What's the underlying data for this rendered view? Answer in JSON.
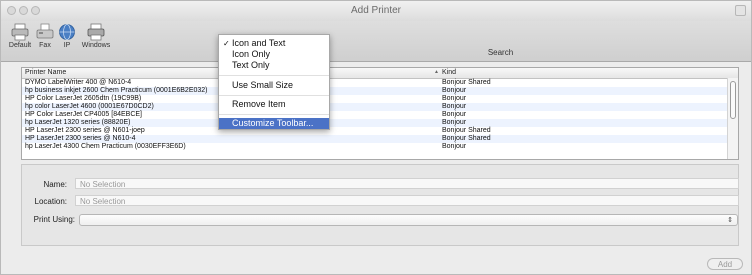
{
  "window": {
    "title": "Add Printer"
  },
  "toolbar": {
    "items": [
      {
        "label": "Default",
        "icon": "default-printer-icon"
      },
      {
        "label": "Fax",
        "icon": "fax-icon"
      },
      {
        "label": "IP",
        "icon": "ip-globe-icon"
      },
      {
        "label": "Windows",
        "icon": "windows-printer-icon"
      }
    ],
    "search_label": "Search"
  },
  "context_menu": {
    "items": [
      {
        "label": "Icon and Text",
        "checked": true
      },
      {
        "label": "Icon Only",
        "checked": false
      },
      {
        "label": "Text Only",
        "checked": false
      },
      {
        "label": "Use Small Size",
        "checked": false
      },
      {
        "label": "Remove Item",
        "checked": false
      },
      {
        "label": "Customize Toolbar...",
        "checked": false,
        "highlighted": true
      }
    ],
    "checkmark": "✓"
  },
  "printer_list": {
    "columns": {
      "name": "Printer Name",
      "kind": "Kind",
      "sort_indicator": "▲"
    },
    "rows": [
      {
        "name": "DYMO LabelWriter 400 @ N610-4",
        "kind": "Bonjour Shared"
      },
      {
        "name": "hp business inkjet 2600 Chem Practicum (0001E6B2E032)",
        "kind": "Bonjour"
      },
      {
        "name": "HP Color LaserJet 2605dtn (19C99B)",
        "kind": "Bonjour"
      },
      {
        "name": "hp color LaserJet 4600 (0001E67D0CD2)",
        "kind": "Bonjour"
      },
      {
        "name": "HP Color LaserJet CP4005 [84EBCE]",
        "kind": "Bonjour"
      },
      {
        "name": "hp LaserJet 1320 series (88820E)",
        "kind": "Bonjour"
      },
      {
        "name": "HP LaserJet 2300 series @ N601-joep",
        "kind": "Bonjour Shared"
      },
      {
        "name": "HP LaserJet 2300 series @ N610-4",
        "kind": "Bonjour Shared"
      },
      {
        "name": "hp LaserJet 4300 Chem Practicum (0030EFF3E6D)",
        "kind": "Bonjour"
      }
    ]
  },
  "details": {
    "name_label": "Name:",
    "name_value": "No Selection",
    "location_label": "Location:",
    "location_value": "No Selection",
    "print_using_label": "Print Using:",
    "print_using_value": ""
  },
  "footer": {
    "add_label": "Add"
  }
}
